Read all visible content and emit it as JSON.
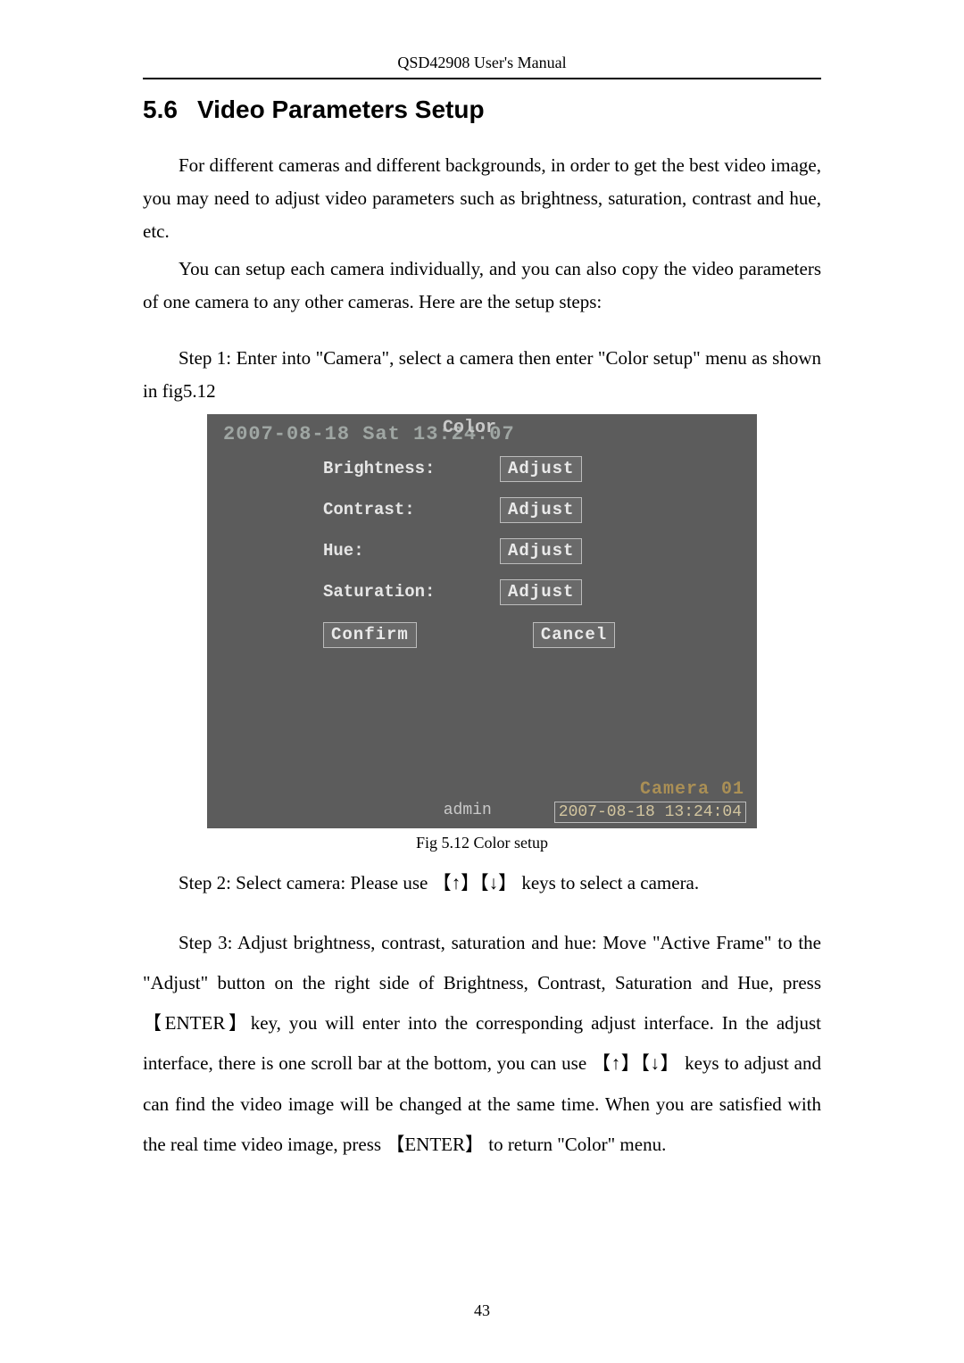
{
  "header": "QSD42908 User's Manual",
  "section": {
    "number": "5.6",
    "title": "Video Parameters Setup"
  },
  "para1": "For different cameras and different backgrounds, in order to get the best video image, you may need to adjust video parameters such as brightness, saturation, contrast and hue, etc.",
  "para2": "You can setup each camera individually, and you can also copy the video parameters of one camera to any other cameras. Here are the setup steps:",
  "para3": "Step 1: Enter into \"Camera\", select a camera then enter \"Color setup\" menu as shown in fig5.12",
  "screenshot": {
    "top_time": "2007-08-18 Sat 13:24:07",
    "menu_title": "Color",
    "rows": {
      "brightness": {
        "label": "Brightness:",
        "btn": "Adjust"
      },
      "contrast": {
        "label": "Contrast:",
        "btn": "Adjust"
      },
      "hue": {
        "label": "Hue:",
        "btn": "Adjust"
      },
      "saturation": {
        "label": "Saturation:",
        "btn": "Adjust"
      }
    },
    "confirm": "Confirm",
    "cancel": "Cancel",
    "camera_label": "Camera 01",
    "admin": "admin",
    "timestamp": "2007-08-18 13:24:04"
  },
  "fig_caption": "Fig 5.12 Color setup",
  "para4": "Step 2: Select camera: Please use 【↑】【↓】 keys to select a camera.",
  "para5": "Step 3: Adjust brightness, contrast, saturation and hue: Move \"Active Frame\" to the \"Adjust\" button on the right side of Brightness, Contrast, Saturation and Hue, press 【ENTER】key, you will enter into the corresponding adjust interface. In the adjust interface, there is one scroll bar at the bottom, you can use 【↑】【↓】 keys to adjust and can find the video image will be changed at the same time. When you are satisfied with the real time video image, press 【ENTER】 to return \"Color\" menu.",
  "page_number": "43"
}
